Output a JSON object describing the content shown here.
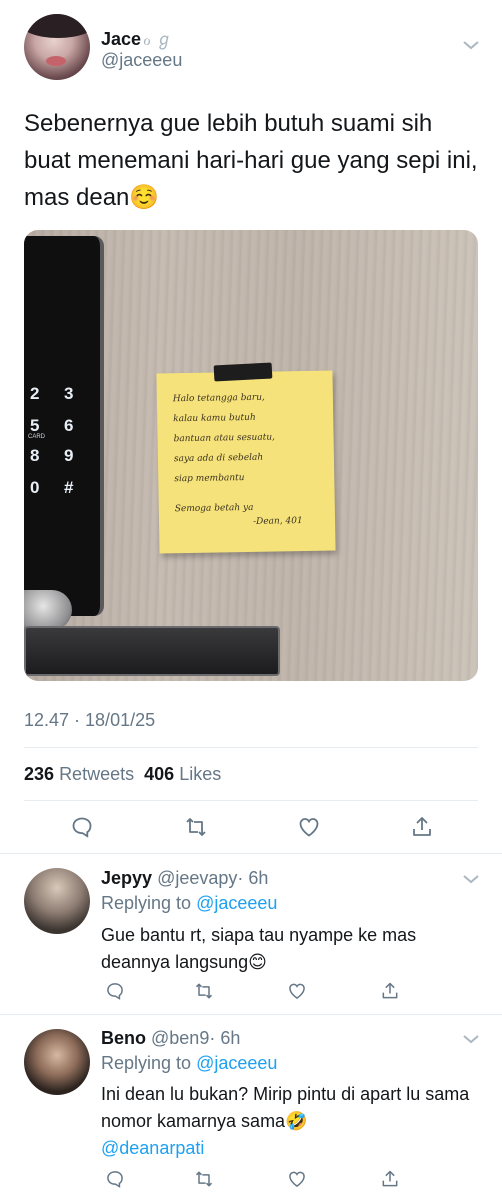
{
  "tweet": {
    "author_name": "Jace",
    "author_badge": "ℴ ℊ",
    "author_handle": "@jaceeeu",
    "text": "Sebenernya gue lebih butuh suami sih buat menemani hari-hari gue yang sepi ini, mas dean☺️",
    "timestamp": "12.47 · 18/01/25",
    "retweets_count": "236",
    "retweets_label": "Retweets",
    "likes_count": "406",
    "likes_label": "Likes"
  },
  "photo": {
    "keypad": [
      "2",
      "3",
      "5",
      "6",
      "8",
      "9",
      "0",
      "#"
    ],
    "card_label": "CARD",
    "note_lines": [
      "Halo tetangga baru,",
      "kalau kamu butuh",
      "bantuan atau sesuatu,",
      "saya ada di sebelah",
      "siap membantu",
      "Semoga betah ya",
      "-Dean, 401"
    ]
  },
  "replies": [
    {
      "name": "Jepyy",
      "handle": "@jeevapy",
      "time": "· 6h",
      "replying_prefix": "Replying to",
      "replying_to": "@jaceeeu",
      "text": "Gue bantu rt, siapa tau nyampe ke mas deannya langsung😊",
      "mention": ""
    },
    {
      "name": "Beno",
      "handle": "@ben9",
      "time": "· 6h",
      "replying_prefix": "Replying to",
      "replying_to": "@jaceeeu",
      "text": "Ini dean lu bukan? Mirip pintu di apart lu sama nomor kamarnya sama🤣",
      "mention": "@deanarpati"
    }
  ],
  "icons": {
    "reply": "comment-icon",
    "retweet": "retweet-icon",
    "like": "heart-icon",
    "share": "share-icon",
    "more": "chevron-down-icon"
  },
  "colors": {
    "link": "#1da1f2",
    "secondary_text": "#657786",
    "icon": "#657786",
    "divider": "#e6ecf0"
  }
}
